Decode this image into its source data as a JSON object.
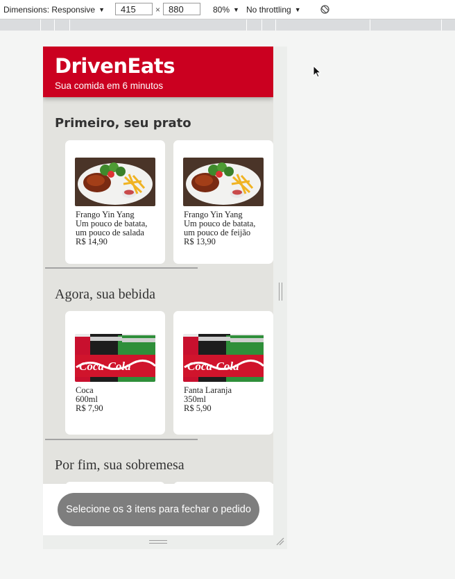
{
  "devtools": {
    "dimensions_label": "Dimensions: Responsive",
    "width": "415",
    "times": "×",
    "height": "880",
    "zoom": "80%",
    "throttling": "No throttling",
    "rotate_icon": "rotate-icon",
    "dropdown_icon": "caret-down-icon"
  },
  "app": {
    "brand": "DrivenEats",
    "tagline": "Sua comida em 6 minutos",
    "brand_color": "#cb0020",
    "sections": [
      {
        "title": "Primeiro, seu prato",
        "items": [
          {
            "name": "Frango Yin Yang",
            "desc1": "Um pouco de batata,",
            "desc2": "um pouco de salada",
            "price": "R$ 14,90",
            "image": "chicken-plate-image"
          },
          {
            "name": "Frango Yin Yang",
            "desc1": "Um pouco de batata,",
            "desc2": "um pouco de feijão",
            "price": "R$ 13,90",
            "image": "chicken-plate-image"
          }
        ]
      },
      {
        "title": "Agora, sua bebida",
        "items": [
          {
            "name": "Coca",
            "desc1": "600ml",
            "price": "R$ 7,90",
            "image": "coca-cola-cans-image"
          },
          {
            "name": "Fanta Laranja",
            "desc1": "350ml",
            "price": "R$ 5,90",
            "image": "coca-cola-cans-image"
          }
        ]
      },
      {
        "title": "Por fim, sua sobremesa"
      }
    ],
    "order_button": "Selecione os 3 itens para fechar o pedido",
    "order_button_color": "#7e7e7e"
  }
}
